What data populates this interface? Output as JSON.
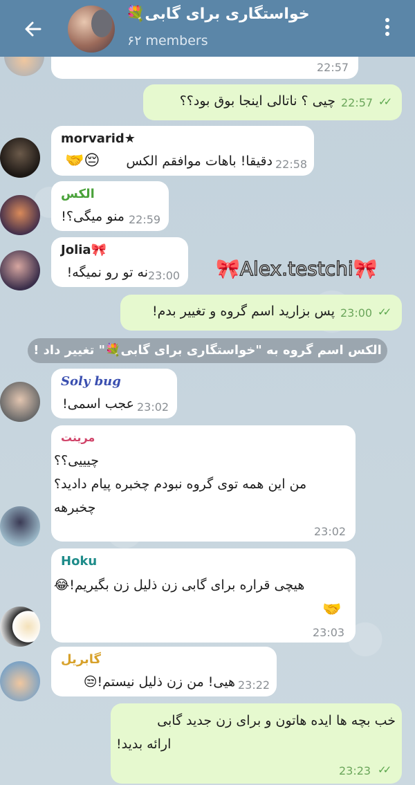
{
  "header": {
    "back_icon": "arrow-left-icon",
    "title": "خواستگاری برای گابی💐",
    "subtitle": "۶۲ members",
    "menu_icon": "more-vertical-icon"
  },
  "messages": [
    {
      "id": "m0",
      "sender": "",
      "text": "",
      "time": "22:57"
    },
    {
      "id": "m1",
      "outgoing": true,
      "text": "چیی ؟ ناتالی اینجا بوق بود؟؟",
      "time": "22:57"
    },
    {
      "id": "m2",
      "sender": "morvarid★",
      "text": "دقیقا! باهات موافقم الکس😔🤝",
      "text_main": "دقیقا! باهات موافقم الکس",
      "emoji": "😔🤝",
      "time": "22:58"
    },
    {
      "id": "m3",
      "sender": "الکس",
      "text": "منو میگی؟!",
      "time": "22:59"
    },
    {
      "id": "m4",
      "sender": "Jolia🎀",
      "text": "نه تو رو نمیگه!",
      "time": "23:00"
    },
    {
      "id": "m5",
      "outgoing": true,
      "text": "پس بزارید اسم گروه و تغییر بدم!",
      "time": "23:00"
    },
    {
      "id": "m6",
      "sender": "Soly bug",
      "text": "عجب اسمی!",
      "time": "23:02"
    },
    {
      "id": "m7",
      "sender": "مرینت",
      "lines": [
        "چیییی؟؟",
        "من این همه توی گروه نبودم چخبره پیام دادید؟",
        "چخبرهه"
      ],
      "time": "23:02"
    },
    {
      "id": "m8",
      "sender": "Hoku",
      "text": "هیچی قراره برای گابی زن ذلیل زن بگیریم!😂",
      "emoji_line": "🤝",
      "time": "23:03"
    },
    {
      "id": "m9",
      "sender": "گابریل",
      "text": "هیی! من زن ذلیل نیستم!😒",
      "time": "23:22"
    },
    {
      "id": "m10",
      "outgoing": true,
      "lines": [
        "خب بچه ها ایده هاتون و برای زن جدید گابی",
        "ارائه بدید!"
      ],
      "time": "23:23"
    }
  ],
  "service_message": "الکس اسم گروه به \"خواستگاری برای گابی💐\" تغییر داد !",
  "watermark": "🎀Alex.testchi🎀",
  "colors": {
    "header": "#5b86a8",
    "outgoing_bubble": "#e6f9cf",
    "name_morvarid": "#222222",
    "name_alex": "#4aa23a",
    "name_jolia": "#222222",
    "name_soly": "#3a4fb0",
    "name_marinette": "#d1456a",
    "name_hoku": "#1f8c8a",
    "name_gabriel": "#d7a12b"
  }
}
